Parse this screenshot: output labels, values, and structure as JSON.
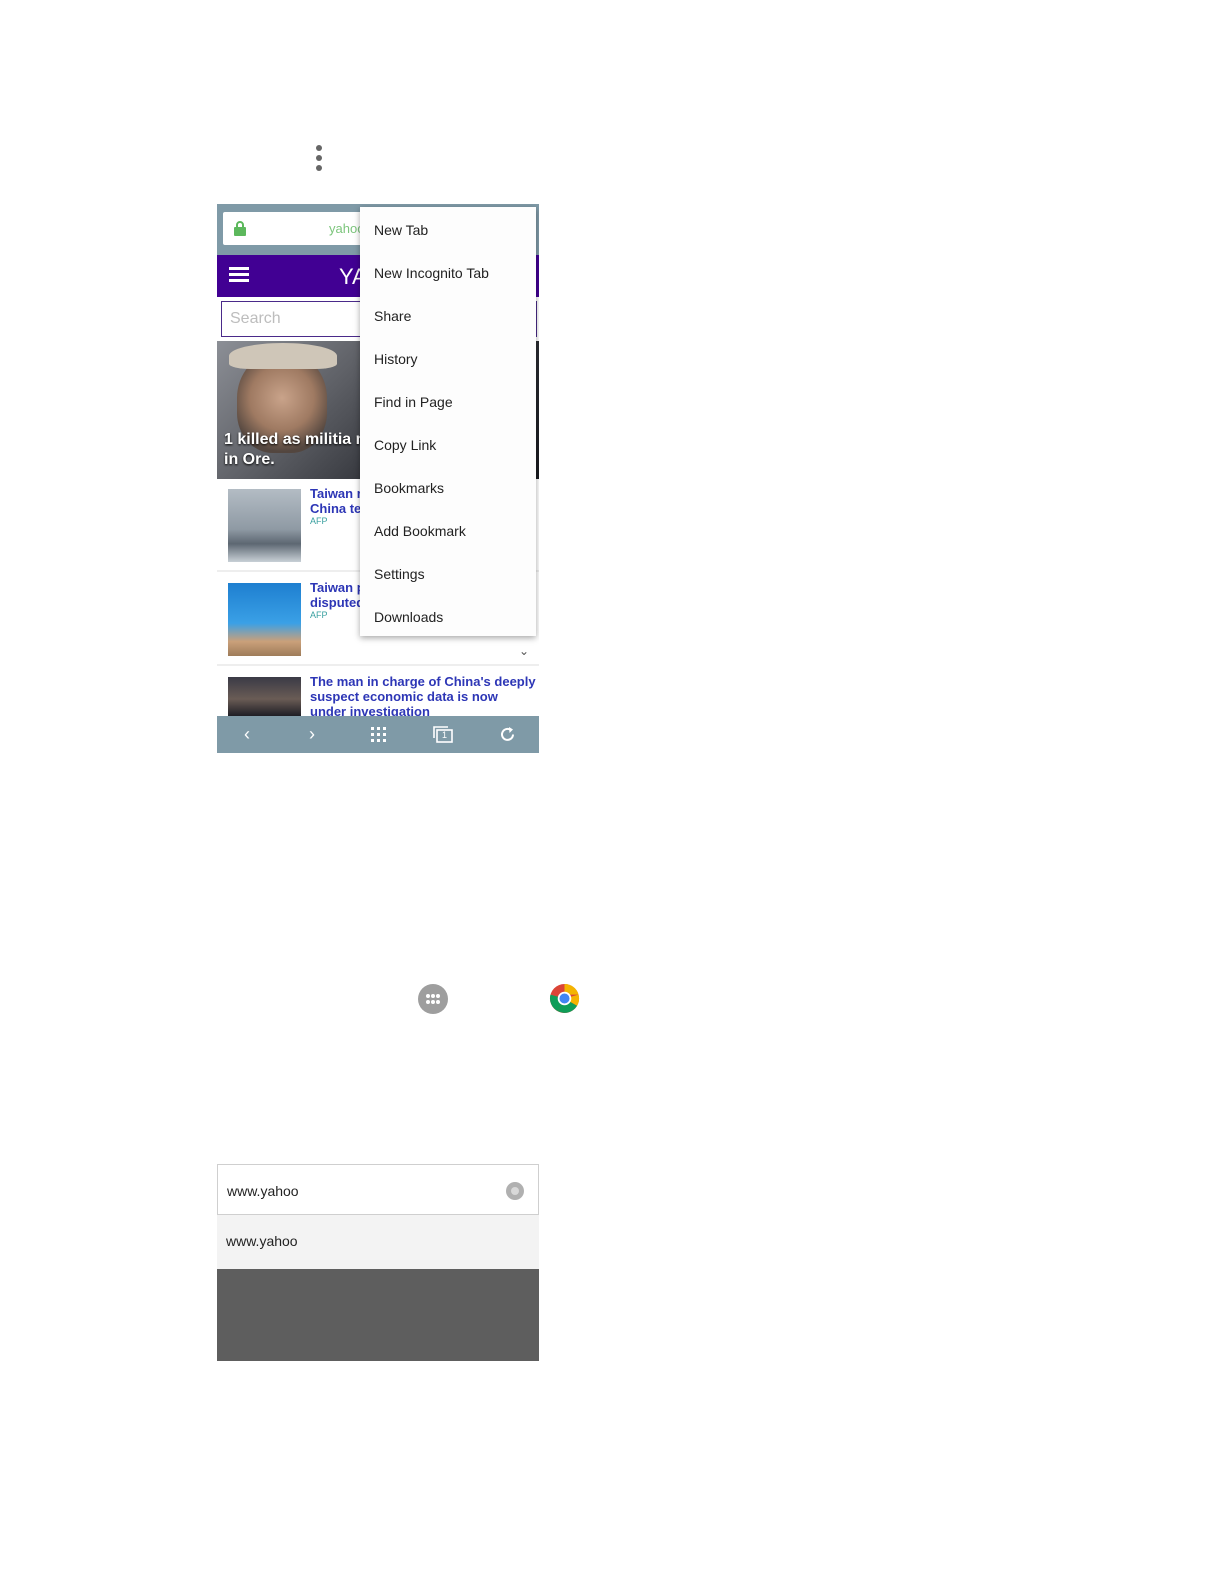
{
  "menu_button": {
    "icon": "kebab-menu-icon"
  },
  "browser": {
    "url_text": "yahoo",
    "logo": "YA",
    "search_placeholder": "Search",
    "hero_title": "1 killed as militia m\nin Ore.",
    "hero_title_line1": "1 killed as militia m",
    "hero_title_line2": "in Ore.",
    "news": [
      {
        "title_line1": "Taiwan r",
        "title_line2": "China te",
        "source": "AFP"
      },
      {
        "title_line1": "Taiwan p",
        "title_line2": "disputed",
        "source": "AFP"
      },
      {
        "title_line1": "The man in charge of China's deeply",
        "title_line2": "suspect economic data is now",
        "title_line3": "under investigation"
      }
    ],
    "bottom_icons": [
      "back-icon",
      "forward-icon",
      "apps-grid-icon",
      "tabs-icon",
      "refresh-icon"
    ],
    "tabs_count": "1"
  },
  "menu": {
    "items": [
      "New Tab",
      "New Incognito Tab",
      "Share",
      "History",
      "Find in Page",
      "Copy Link",
      "Bookmarks",
      "Add Bookmark",
      "Settings",
      "Downloads"
    ]
  },
  "launcher": {
    "apps_icon": "apps-icon",
    "chrome_icon": "chrome-icon"
  },
  "address_entry": {
    "field_value": "www.yahoo",
    "suggestion": "www.yahoo"
  },
  "colors": {
    "yahoo_purple": "#410093",
    "toolbar": "#7f9aa7",
    "link_blue": "#2d36b6"
  }
}
